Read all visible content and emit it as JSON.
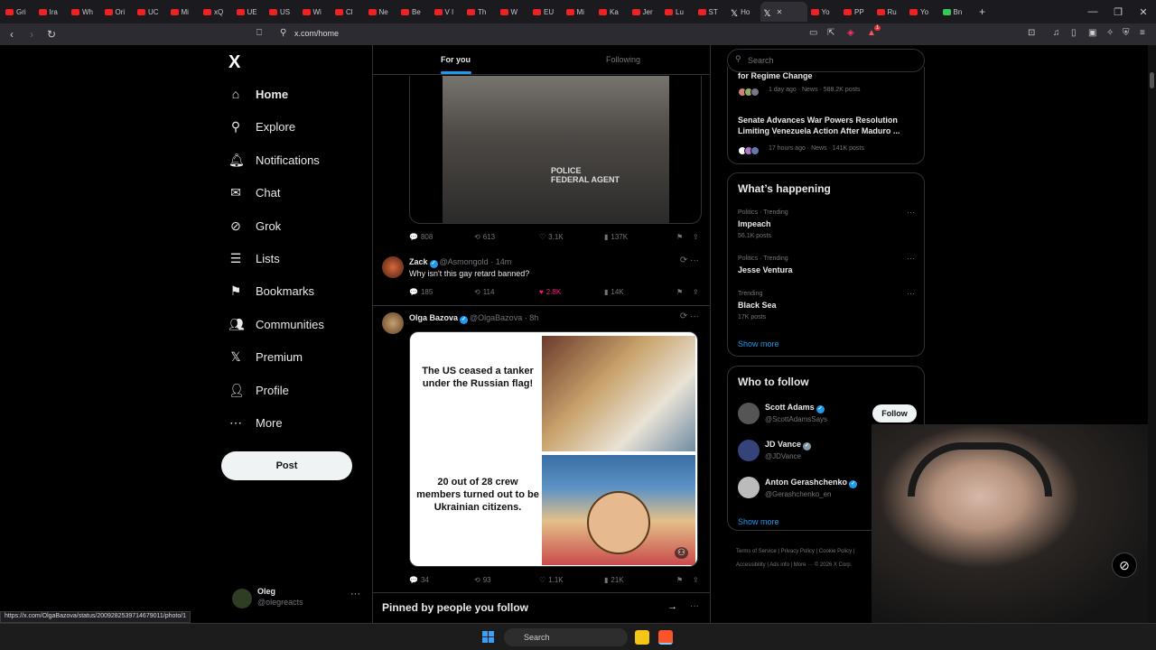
{
  "browser": {
    "tabs": [
      "Gri",
      "Ira",
      "Wh",
      "Ori",
      "UC",
      "Mi",
      "xQ",
      "UE",
      "US",
      "Wi",
      "Cl",
      "Ne",
      "Be",
      "V I",
      "Th",
      "W",
      "EU",
      "Mi",
      "Ka",
      "Jer",
      "Lu",
      "ST",
      "Ho",
      "",
      "Yo",
      "PP",
      "Ru",
      "Yo",
      "Bn"
    ],
    "new_tab": "+",
    "url": "x.com/home",
    "status_url": "https://x.com/OlgaBazova/status/2009282539714679011/photo/1",
    "badge_count": "1"
  },
  "left_nav": {
    "logo": "X",
    "items": [
      {
        "label": "Home",
        "icon": "home-icon"
      },
      {
        "label": "Explore",
        "icon": "search-icon"
      },
      {
        "label": "Notifications",
        "icon": "bell-icon"
      },
      {
        "label": "Chat",
        "icon": "mail-icon"
      },
      {
        "label": "Grok",
        "icon": "grok-icon"
      },
      {
        "label": "Lists",
        "icon": "list-icon"
      },
      {
        "label": "Bookmarks",
        "icon": "bookmark-icon"
      },
      {
        "label": "Communities",
        "icon": "communities-icon"
      },
      {
        "label": "Premium",
        "icon": "x-icon"
      },
      {
        "label": "Profile",
        "icon": "person-icon"
      },
      {
        "label": "More",
        "icon": "more-icon"
      }
    ],
    "post_label": "Post",
    "account": {
      "name": "Oleg",
      "handle": "@olegreacts",
      "more": "···"
    }
  },
  "feed": {
    "tabs": [
      "For you",
      "Following"
    ],
    "tweet0": {
      "media_text": "POLICE\nFEDERAL AGENT",
      "replies": "808",
      "reposts": "613",
      "likes": "3.1K",
      "views": "137K"
    },
    "tweet1": {
      "name": "Zack",
      "handle": "@Asmongold",
      "time": "· 14m",
      "text": "Why isn't this gay retard banned?",
      "replies": "185",
      "reposts": "114",
      "likes": "2.8K",
      "views": "14K"
    },
    "tweet2": {
      "name": "Olga Bazova",
      "handle": "@OlgaBazova",
      "time": "· 8h",
      "meme_top": "The US ceased a tanker under the Russian flag!",
      "meme_bottom": "20 out of 28 crew members turned out to be Ukrainian citizens.",
      "replies": "34",
      "reposts": "93",
      "likes": "1.1K",
      "views": "21K"
    },
    "pinned_heading": "Pinned by people you follow"
  },
  "right": {
    "search_placeholder": "Search",
    "news": [
      {
        "title": "for Regime Change",
        "meta": "1 day ago · News · 588.2K posts"
      },
      {
        "title": "Senate Advances War Powers Resolution Limiting Venezuela Action After Maduro ...",
        "meta": "17 hours ago · News · 141K posts"
      }
    ],
    "whats_happening": "What’s happening",
    "trends": [
      {
        "category": "Politics · Trending",
        "name": "Impeach",
        "posts": "56.1K posts"
      },
      {
        "category": "Politics · Trending",
        "name": "Jesse Ventura",
        "posts": ""
      },
      {
        "category": "Trending",
        "name": "Black Sea",
        "posts": "17K posts"
      }
    ],
    "show_more": "Show more",
    "who_to_follow": "Who to follow",
    "follow": [
      {
        "name": "Scott Adams",
        "handle": "@ScottAdamsSays"
      },
      {
        "name": "JD Vance",
        "handle": "@JDVance"
      },
      {
        "name": "Anton Gerashchenko",
        "handle": "@Gerashchenko_en"
      }
    ],
    "follow_label": "Follow",
    "footer1": "Terms of Service  |  Privacy Policy  |  Cookie Policy  |",
    "footer2": "Accessibility  |  Ads info  |  More ···  © 2026 X Corp."
  },
  "taskbar": {
    "search_label": "Search"
  }
}
